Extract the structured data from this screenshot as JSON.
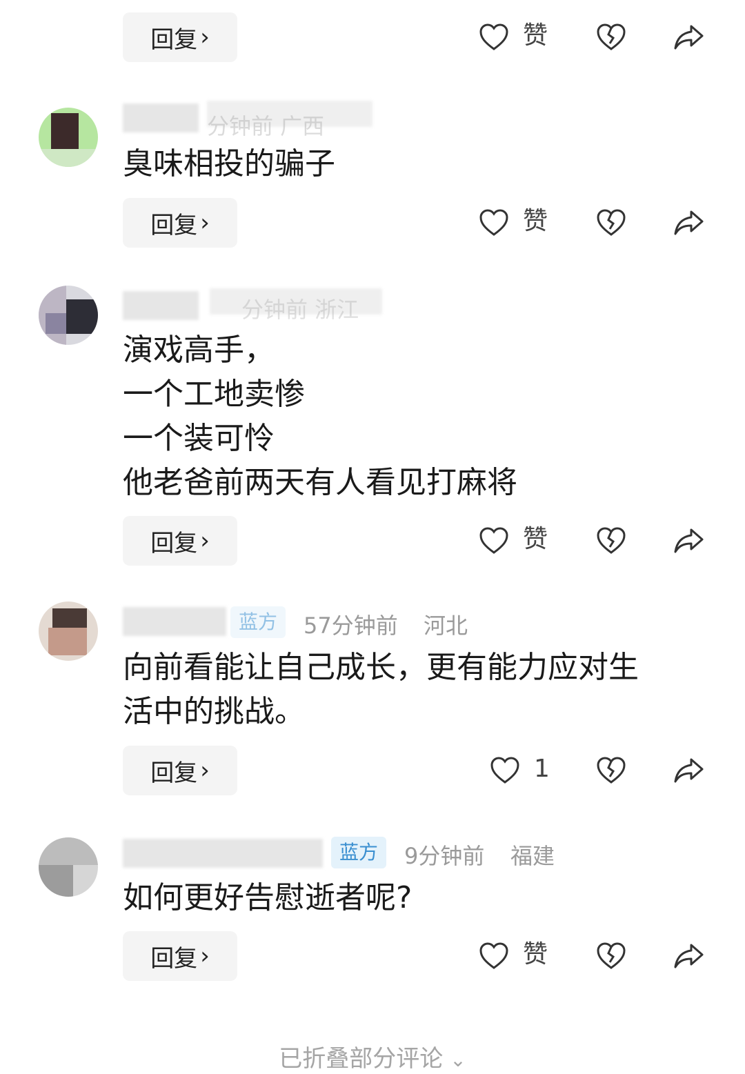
{
  "comments": [
    {
      "text": "",
      "reply": "回复",
      "like_label": "赞"
    },
    {
      "meta": "分钟前  广西",
      "text": "臭味相投的骗子",
      "reply": "回复",
      "like_label": "赞"
    },
    {
      "meta": "分钟前  浙江",
      "lines": [
        "演戏高手，",
        "一个工地卖惨",
        "一个装可怜",
        "他老爸前两天有人看见打麻将"
      ],
      "reply": "回复",
      "like_label": "赞"
    },
    {
      "tag": "蓝方",
      "time": "57分钟前",
      "location": "河北",
      "lines": [
        "向前看能让自己成长，更有能力应对生",
        "活中的挑战。"
      ],
      "reply": "回复",
      "like_count": "1"
    },
    {
      "tag": "蓝方",
      "time": "9分钟前",
      "location": "福建",
      "text": "如何更好告慰逝者呢?",
      "reply": "回复",
      "like_label": "赞"
    }
  ],
  "footer": {
    "collapsed_label": "已折叠部分评论"
  },
  "icons": {
    "like": "heart-icon",
    "dislike": "broken-heart-icon",
    "share": "share-arrow-icon",
    "chevron": "chevron-right-icon"
  },
  "colors": {
    "tag_bg": "#e4f2fb",
    "tag_text": "#3a8fd0",
    "muted": "#9a9a9a",
    "reply_bg": "#f4f4f4"
  }
}
